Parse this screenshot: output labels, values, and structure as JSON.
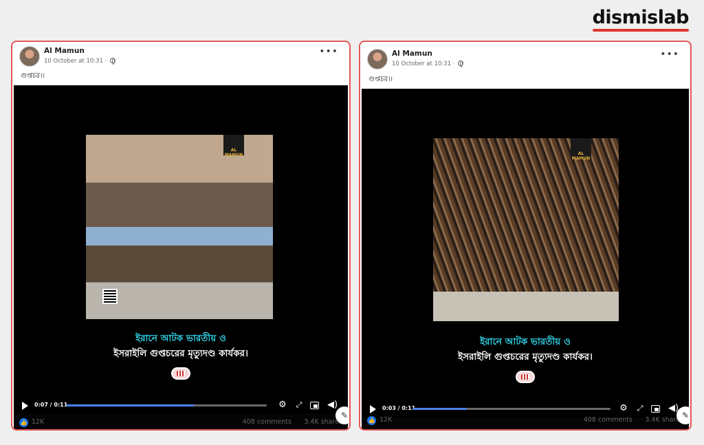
{
  "brand": {
    "name": "dismislab",
    "accent": "#e0342f"
  },
  "posts": [
    {
      "author": "Al Mamun",
      "meta": "10 October at 10:31 ·",
      "caption": "গুপ্তচর।।",
      "more": "•••",
      "video": {
        "overlay_line1": "ইরানে আটক ভারতীয় ও",
        "overlay_line2": "ইসরাইলি গুপ্তচরের মৃত্যুদণ্ড কার্যকর।",
        "logo_text": "AL MAMUN",
        "time": "0:07 / 0:11",
        "progress": 0.6364
      },
      "likes": "12K",
      "comments": "408 comments",
      "shares": "3.4K shares"
    },
    {
      "author": "Al Mamun",
      "meta": "10 October at 10:31 ·",
      "caption": "গুপ্তচর।।",
      "more": "•••",
      "video": {
        "overlay_line1": "ইরানে আটক ভারতীয় ও",
        "overlay_line2": "ইসরাইলি গুপ্তচরের মৃত্যুদণ্ড কার্যকর।",
        "logo_text": "AL MAMUN",
        "time": "0:03 / 0:11",
        "progress": 0.2727
      },
      "likes": "12K",
      "comments": "408 comments",
      "shares": "3.4K shares"
    }
  ],
  "icons": {
    "more": "horizontal-dots-icon",
    "play": "play-icon",
    "settings": "gear-icon",
    "expand": "expand-icon",
    "pip": "picture-in-picture-icon",
    "volume": "volume-icon",
    "like": "thumbs-up-icon",
    "edit": "edit-icon"
  }
}
